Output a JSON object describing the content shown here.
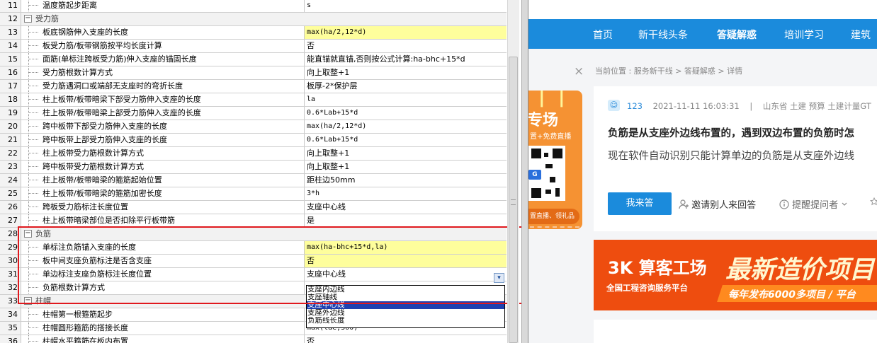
{
  "grid": {
    "rows": [
      {
        "num": "11",
        "name": "温度筋起步距离",
        "value": "s",
        "kind": "item"
      },
      {
        "num": "12",
        "name": "受力筋",
        "value": "",
        "kind": "category"
      },
      {
        "num": "13",
        "name": "板底钢筋伸入支座的长度",
        "value": "max(ha/2,12*d)",
        "kind": "item",
        "highlight": true
      },
      {
        "num": "14",
        "name": "板受力筋/板带钢筋按平均长度计算",
        "value": "否",
        "kind": "item"
      },
      {
        "num": "15",
        "name": "面筋(单标注跨板受力筋)伸入支座的锚固长度",
        "value": "能直锚就直锚,否则按公式计算:ha-bhc+15*d",
        "kind": "item"
      },
      {
        "num": "16",
        "name": "受力筋根数计算方式",
        "value": "向上取整+1",
        "kind": "item"
      },
      {
        "num": "17",
        "name": "受力筋遇洞口或端部无支座时的弯折长度",
        "value": "板厚-2*保护层",
        "kind": "item"
      },
      {
        "num": "18",
        "name": "柱上板带/板带暗梁下部受力筋伸入支座的长度",
        "value": "la",
        "kind": "item"
      },
      {
        "num": "19",
        "name": "柱上板带/板带暗梁上部受力筋伸入支座的长度",
        "value": "0.6*Lab+15*d",
        "kind": "item"
      },
      {
        "num": "20",
        "name": "跨中板带下部受力筋伸入支座的长度",
        "value": "max(ha/2,12*d)",
        "kind": "item"
      },
      {
        "num": "21",
        "name": "跨中板带上部受力筋伸入支座的长度",
        "value": "0.6*Lab+15*d",
        "kind": "item"
      },
      {
        "num": "22",
        "name": "柱上板带受力筋根数计算方式",
        "value": "向上取整+1",
        "kind": "item"
      },
      {
        "num": "23",
        "name": "跨中板带受力筋根数计算方式",
        "value": "向上取整+1",
        "kind": "item"
      },
      {
        "num": "24",
        "name": "柱上板带/板带暗梁的箍筋起始位置",
        "value": "距柱边50mm",
        "kind": "item"
      },
      {
        "num": "25",
        "name": "柱上板带/板带暗梁的箍筋加密长度",
        "value": "3*h",
        "kind": "item"
      },
      {
        "num": "26",
        "name": "跨板受力筋标注长度位置",
        "value": "支座中心线",
        "kind": "item"
      },
      {
        "num": "27",
        "name": "柱上板带暗梁部位是否扣除平行板带筋",
        "value": "是",
        "kind": "item"
      },
      {
        "num": "28",
        "name": "负筋",
        "value": "",
        "kind": "category"
      },
      {
        "num": "29",
        "name": "单标注负筋锚入支座的长度",
        "value": "max(ha-bhc+15*d,la)",
        "kind": "item",
        "highlight": true
      },
      {
        "num": "30",
        "name": "板中间支座负筋标注是否含支座",
        "value": "否",
        "kind": "item",
        "highlight": true
      },
      {
        "num": "31",
        "name": "单边标注支座负筋标注长度位置",
        "value": "支座中心线",
        "kind": "item"
      },
      {
        "num": "32",
        "name": "负筋根数计算方式",
        "value": "",
        "kind": "item"
      },
      {
        "num": "33",
        "name": "柱帽",
        "value": "",
        "kind": "category"
      },
      {
        "num": "34",
        "name": "柱帽第一根箍筋起步",
        "value": "",
        "kind": "item"
      },
      {
        "num": "35",
        "name": "柱帽圆形箍筋的搭接长度",
        "value": "max(lae,300)",
        "kind": "item"
      },
      {
        "num": "36",
        "name": "柱帽水平箍筋在板内布置",
        "value": "否",
        "kind": "item"
      }
    ],
    "dropdown": {
      "arrow": "▾",
      "options": [
        "支座内边线",
        "支座轴线",
        "支座中心线",
        "支座外边线",
        "负筋线长度"
      ],
      "selected_index": 2
    },
    "expand_glyph": "−"
  },
  "web": {
    "nav": [
      "首页",
      "新干线头条",
      "答疑解惑",
      "培训学习",
      "建筑"
    ],
    "nav_active": 2,
    "breadcrumb": "当前位置 : 服务新干线 > 答疑解惑 > 详情",
    "close_glyph": "×",
    "promo": {
      "title": "专场",
      "sub": "置+免费直播",
      "badge": "G",
      "pill": "置直播、领礼品"
    },
    "question": {
      "user": "123",
      "time": "2021-11-11 16:03:31",
      "sep": "|",
      "tags": "山东省 土建 预算 土建计量GT",
      "title": "负筋是从支座外边线布置的，遇到双边布置的负筋时怎",
      "body": "现在软件自动识别只能计算单边的负筋是从支座外边线",
      "answer_button": "我来答",
      "invite": "邀请别人来回答",
      "remind": "提醒提问者",
      "user_icon": "☺"
    },
    "banner": {
      "logo": "3K 算客工场",
      "sub": "全国工程咨询服务平台",
      "headline": "最新造价项目",
      "pill": "每年发布6000多项目 / 平台"
    }
  },
  "colors": {
    "highlight": "#fefe9c",
    "nav_blue": "#1b8bdc",
    "annotation_red": "#e0191e",
    "banner_orange": "#ee4d0f",
    "promo_orange": "#f59233"
  }
}
